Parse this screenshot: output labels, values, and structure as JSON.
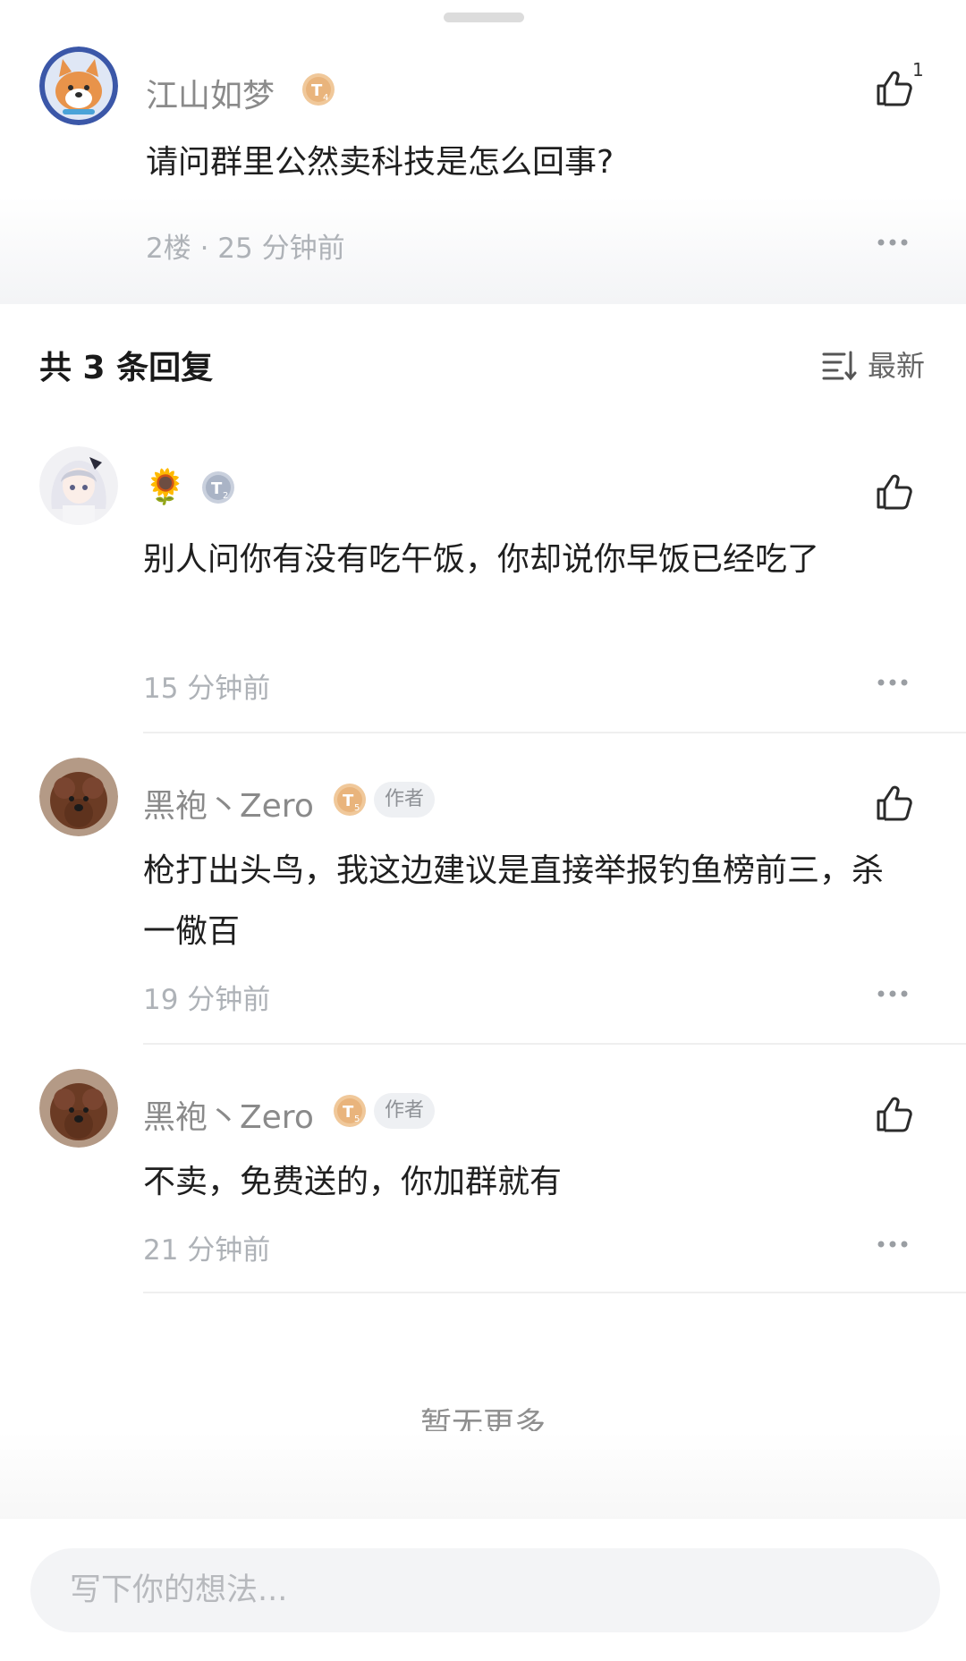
{
  "main_comment": {
    "username": "江山如梦",
    "level_badge": "T4",
    "text": "请问群里公然卖科技是怎么回事?",
    "meta": "2楼 · 25 分钟前",
    "like_count": "1",
    "avatar_icon": "shiba-dog-avatar"
  },
  "replies_header": {
    "title": "共 3 条回复",
    "sort_label": "最新"
  },
  "replies": [
    {
      "username": "",
      "emoji": "🌻",
      "level_badge": "T2",
      "text": "别人问你有没有吃午饭，你却说你早饭已经吃了",
      "time": "15 分钟前",
      "avatar_icon": "anime-girl-avatar"
    },
    {
      "username": "黑袍丶Zero",
      "level_badge": "T5",
      "author_tag": "作者",
      "text_line1": "枪打出头鸟，我这边建议是直接举报钓鱼榜前三，杀",
      "text_line2": "一儆百",
      "time": "19 分钟前",
      "avatar_icon": "poodle-dog-avatar"
    },
    {
      "username": "黑袍丶Zero",
      "level_badge": "T5",
      "author_tag": "作者",
      "text": "不卖，免费送的，你加群就有",
      "time": "21 分钟前",
      "avatar_icon": "poodle-dog-avatar"
    }
  ],
  "footer": {
    "no_more": "暂无更多"
  },
  "composer": {
    "placeholder": "写下你的想法..."
  }
}
